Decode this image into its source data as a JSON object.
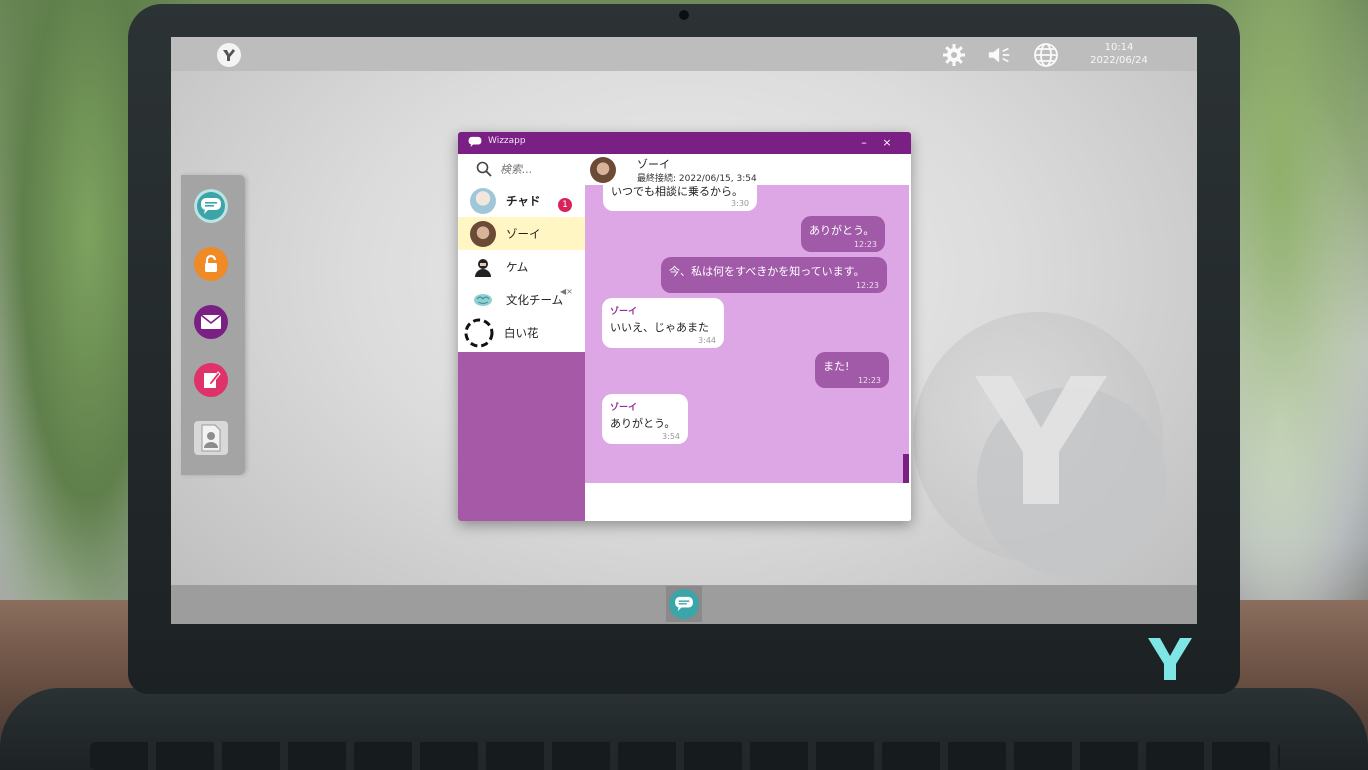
{
  "os": {
    "clock_time": "10:14",
    "clock_date": "2022/06/24",
    "topbar_icons": [
      "settings-gear-icon",
      "speaker-icon",
      "globe-icon"
    ],
    "dock": [
      {
        "id": "chat",
        "icon": "chat-bubble-icon",
        "color": "#3aa6a9"
      },
      {
        "id": "lock",
        "icon": "padlock-icon",
        "color": "#f08a24"
      },
      {
        "id": "mail",
        "icon": "envelope-icon",
        "color": "#7a1f83"
      },
      {
        "id": "notes",
        "icon": "note-pen-icon",
        "color": "#e0326a"
      },
      {
        "id": "profile",
        "icon": "profile-card-icon",
        "color": "#d8d8d8"
      }
    ]
  },
  "app": {
    "title": "Wizzapp",
    "minimize": "–",
    "close": "×",
    "search": {
      "placeholder": "検索..."
    },
    "contacts": [
      {
        "name": "チャド",
        "unread": "1",
        "bold": true
      },
      {
        "name": "ゾーイ",
        "active": true
      },
      {
        "name": "ケム"
      },
      {
        "name": "文化チーム",
        "muted": true
      },
      {
        "name": "白い花"
      }
    ],
    "chat": {
      "contact_name": "ゾーイ",
      "last_seen": "最終接続: 2022/06/15, 3:54",
      "messages": [
        {
          "dir": "in",
          "text": "いつでも相談に乗るから。",
          "time": "3:30"
        },
        {
          "dir": "out",
          "text": "ありがとう。",
          "time": "12:23"
        },
        {
          "dir": "out",
          "text": "今、私は何をすべきかを知っています。",
          "time": "12:23"
        },
        {
          "dir": "in",
          "sender": "ゾーイ",
          "text": "いいえ、じゃあまた",
          "time": "3:44"
        },
        {
          "dir": "out",
          "text": "また!",
          "time": "12:23"
        },
        {
          "dir": "in",
          "sender": "ゾーイ",
          "text": "ありがとう。",
          "time": "3:54"
        }
      ]
    }
  },
  "colors": {
    "brand_purple": "#7a1f83",
    "chat_bg": "#dda6e4",
    "outgoing_bubble": "#a05aa8",
    "unread_badge": "#d6245b",
    "active_contact": "#fff6c3",
    "logo_cyan": "#7fe6e6"
  }
}
